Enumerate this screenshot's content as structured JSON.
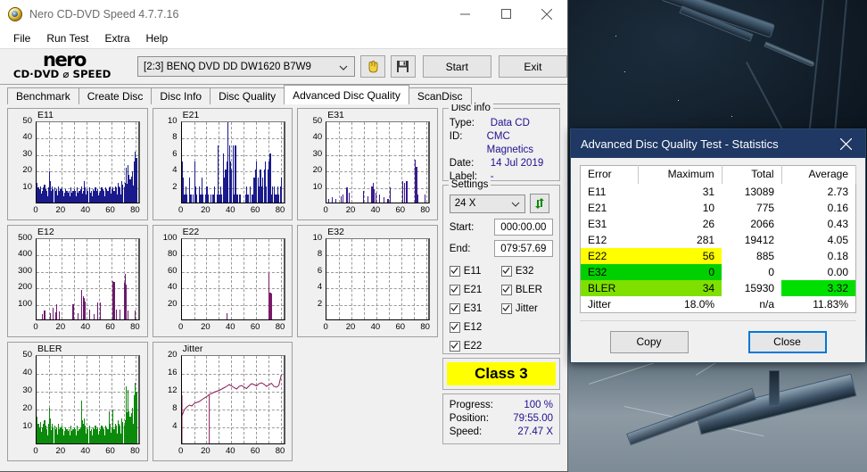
{
  "window": {
    "title": "Nero CD-DVD Speed 4.7.7.16",
    "icon": "nero-disc-icon",
    "controls": {
      "minimize": "minimize-icon",
      "maximize": "maximize-icon",
      "close": "close-icon"
    }
  },
  "menubar": {
    "items": [
      "File",
      "Run Test",
      "Extra",
      "Help"
    ]
  },
  "toolbar": {
    "logo_word": "nero",
    "logo_sub": "CD·DVD ⌀ SPEED",
    "drive": "[2:3]   BENQ DVD DD DW1620 B7W9",
    "eject_icon": "eject-hand-icon",
    "save_icon": "floppy-save-icon",
    "start_label": "Start",
    "exit_label": "Exit"
  },
  "tabs": {
    "items": [
      "Benchmark",
      "Create Disc",
      "Disc Info",
      "Disc Quality",
      "Advanced Disc Quality",
      "ScanDisc"
    ],
    "active": "Advanced Disc Quality"
  },
  "disc_info": {
    "legend": "Disc info",
    "rows": [
      {
        "key": "Type:",
        "value": "Data CD"
      },
      {
        "key": "ID:",
        "value": "CMC Magnetics"
      },
      {
        "key": "Date:",
        "value": "14 Jul 2019"
      },
      {
        "key": "Label:",
        "value": "-"
      }
    ]
  },
  "settings": {
    "legend": "Settings",
    "speed": "24 X",
    "refresh_icon": "refresh-speed-icon",
    "start_label": "Start:",
    "start_value": "000:00.00",
    "end_label": "End:",
    "end_value": "079:57.69",
    "checkboxes": [
      {
        "label": "E11",
        "checked": true
      },
      {
        "label": "E32",
        "checked": true
      },
      {
        "label": "E21",
        "checked": true
      },
      {
        "label": "BLER",
        "checked": true
      },
      {
        "label": "E31",
        "checked": true
      },
      {
        "label": "Jitter",
        "checked": true
      },
      {
        "label": "E12",
        "checked": true
      },
      {
        "label": "",
        "checked": false
      },
      {
        "label": "E22",
        "checked": true
      },
      {
        "label": "",
        "checked": false
      }
    ]
  },
  "class_box": {
    "label": "Class 3",
    "color": "#ffff00"
  },
  "progress": {
    "rows": [
      {
        "key": "Progress:",
        "value": "100 %"
      },
      {
        "key": "Position:",
        "value": "79:55.00"
      },
      {
        "key": "Speed:",
        "value": "27.47 X"
      }
    ]
  },
  "stats_dialog": {
    "title": "Advanced Disc Quality Test - Statistics",
    "close_icon": "close-icon",
    "columns": [
      "Error",
      "Maximum",
      "Total",
      "Average"
    ],
    "rows": [
      {
        "error": "E11",
        "maximum": "31",
        "total": "13089",
        "average": "2.73",
        "hl": null,
        "avg_hl": null
      },
      {
        "error": "E21",
        "maximum": "10",
        "total": "775",
        "average": "0.16",
        "hl": null,
        "avg_hl": null
      },
      {
        "error": "E31",
        "maximum": "26",
        "total": "2066",
        "average": "0.43",
        "hl": null,
        "avg_hl": null
      },
      {
        "error": "E12",
        "maximum": "281",
        "total": "19412",
        "average": "4.05",
        "hl": null,
        "avg_hl": null
      },
      {
        "error": "E22",
        "maximum": "56",
        "total": "885",
        "average": "0.18",
        "hl": "#ffff00",
        "avg_hl": null
      },
      {
        "error": "E32",
        "maximum": "0",
        "total": "0",
        "average": "0.00",
        "hl": "#00d000",
        "avg_hl": null
      },
      {
        "error": "BLER",
        "maximum": "34",
        "total": "15930",
        "average": "3.32",
        "hl": "#7fe000",
        "avg_hl": "#00e000"
      },
      {
        "error": "Jitter",
        "maximum": "18.0%",
        "total": "n/a",
        "average": "11.83%",
        "hl": null,
        "avg_hl": null
      }
    ],
    "copy_label": "Copy",
    "close_label": "Close"
  },
  "chart_data": [
    {
      "type": "bar",
      "title": "E11",
      "color": "#1a1a8c",
      "xlabel": "",
      "ylabel": "",
      "xlim": [
        0,
        84
      ],
      "ylim": [
        0,
        50
      ],
      "grid": true,
      "yticks": [
        10,
        20,
        30,
        40,
        50
      ],
      "xticks": [
        0,
        20,
        40,
        60,
        80
      ],
      "x": [
        0,
        1,
        2,
        3,
        4,
        5,
        6,
        7,
        8,
        9,
        10,
        11,
        12,
        13,
        14,
        15,
        16,
        17,
        18,
        19,
        20,
        21,
        22,
        23,
        24,
        25,
        26,
        27,
        28,
        29,
        30,
        31,
        32,
        33,
        34,
        35,
        36,
        37,
        38,
        39,
        40,
        41,
        42,
        43,
        44,
        45,
        46,
        47,
        48,
        49,
        50,
        51,
        52,
        53,
        54,
        55,
        56,
        57,
        58,
        59,
        60,
        61,
        62,
        63,
        64,
        65,
        66,
        67,
        68,
        69,
        70,
        71,
        72,
        73,
        74,
        75,
        76,
        77,
        78,
        79,
        80
      ],
      "values": [
        12,
        9,
        8,
        10,
        7,
        9,
        11,
        8,
        7,
        9,
        19,
        13,
        10,
        8,
        9,
        7,
        8,
        10,
        7,
        8,
        9,
        7,
        6,
        8,
        7,
        6,
        7,
        9,
        6,
        7,
        8,
        7,
        9,
        6,
        7,
        8,
        10,
        7,
        13,
        9,
        8,
        7,
        9,
        6,
        7,
        8,
        7,
        9,
        7,
        8,
        6,
        7,
        9,
        8,
        7,
        9,
        8,
        7,
        9,
        10,
        8,
        9,
        7,
        10,
        9,
        12,
        10,
        9,
        13,
        11,
        9,
        12,
        21,
        23,
        17,
        14,
        16,
        19,
        25,
        31,
        27
      ]
    },
    {
      "type": "bar",
      "title": "E21",
      "color": "#1a1a8c",
      "xlabel": "",
      "ylabel": "",
      "xlim": [
        0,
        84
      ],
      "ylim": [
        0,
        10
      ],
      "grid": true,
      "yticks": [
        2,
        4,
        6,
        8,
        10
      ],
      "xticks": [
        0,
        20,
        40,
        60,
        80
      ],
      "x": [
        0,
        1,
        2,
        3,
        4,
        5,
        6,
        7,
        8,
        9,
        10,
        11,
        12,
        13,
        14,
        15,
        16,
        17,
        18,
        19,
        20,
        21,
        22,
        23,
        24,
        25,
        26,
        27,
        28,
        29,
        30,
        31,
        32,
        33,
        34,
        35,
        36,
        37,
        38,
        39,
        40,
        41,
        42,
        43,
        44,
        45,
        46,
        47,
        48,
        49,
        50,
        51,
        52,
        53,
        54,
        55,
        56,
        57,
        58,
        59,
        60,
        61,
        62,
        63,
        64,
        65,
        66,
        67,
        68,
        69,
        70,
        71,
        72,
        73,
        74,
        75,
        76,
        77,
        78,
        79,
        80
      ],
      "values": [
        5,
        3,
        1,
        2,
        1,
        0,
        3,
        1,
        0,
        1,
        5,
        2,
        1,
        0,
        2,
        1,
        3,
        1,
        0,
        1,
        2,
        1,
        0,
        1,
        0,
        1,
        2,
        0,
        1,
        7,
        1,
        2,
        1,
        6,
        3,
        4,
        5,
        10,
        7,
        5,
        4,
        7,
        1,
        7,
        1,
        1,
        1,
        1,
        0,
        0,
        0,
        1,
        2,
        1,
        0,
        2,
        1,
        1,
        3,
        4,
        5,
        3,
        2,
        4,
        2,
        3,
        4,
        5,
        2,
        4,
        5,
        6,
        1,
        2,
        2,
        1,
        1,
        2,
        1,
        2,
        3
      ]
    },
    {
      "type": "bar",
      "title": "E31",
      "color": "#3b1a8c",
      "xlabel": "",
      "ylabel": "",
      "xlim": [
        0,
        84
      ],
      "ylim": [
        0,
        50
      ],
      "grid": true,
      "yticks": [
        10,
        20,
        30,
        40,
        50
      ],
      "xticks": [
        0,
        20,
        40,
        60,
        80
      ],
      "x": [
        0,
        1,
        2,
        3,
        4,
        5,
        6,
        7,
        8,
        9,
        10,
        11,
        12,
        13,
        14,
        15,
        16,
        17,
        18,
        19,
        20,
        21,
        22,
        23,
        24,
        25,
        26,
        27,
        28,
        29,
        30,
        31,
        32,
        33,
        34,
        35,
        36,
        37,
        38,
        39,
        40,
        41,
        42,
        43,
        44,
        45,
        46,
        47,
        48,
        49,
        50,
        51,
        52,
        53,
        54,
        55,
        56,
        57,
        58,
        59,
        60,
        61,
        62,
        63,
        64,
        65,
        66,
        67,
        68,
        69,
        70,
        71,
        72,
        73,
        74,
        75,
        76,
        77,
        78,
        79,
        80
      ],
      "values": [
        0,
        2,
        0,
        0,
        3,
        0,
        0,
        2,
        0,
        0,
        0,
        4,
        0,
        5,
        0,
        0,
        9,
        0,
        6,
        0,
        0,
        0,
        0,
        0,
        0,
        0,
        0,
        0,
        0,
        7,
        0,
        0,
        0,
        4,
        0,
        0,
        10,
        12,
        8,
        6,
        0,
        0,
        5,
        0,
        0,
        0,
        3,
        0,
        0,
        2,
        0,
        9,
        0,
        0,
        0,
        0,
        0,
        0,
        0,
        0,
        0,
        13,
        12,
        0,
        13,
        0,
        0,
        0,
        0,
        0,
        0,
        26,
        22,
        5,
        0,
        0,
        0,
        0,
        0,
        5,
        0
      ]
    },
    {
      "type": "bar",
      "title": "E12",
      "color": "#6b1a6b",
      "xlabel": "",
      "ylabel": "",
      "xlim": [
        0,
        84
      ],
      "ylim": [
        0,
        500
      ],
      "grid": true,
      "yticks": [
        100,
        200,
        300,
        400,
        500
      ],
      "xticks": [
        0,
        20,
        40,
        60,
        80
      ],
      "x": [
        0,
        1,
        2,
        3,
        4,
        5,
        6,
        7,
        8,
        9,
        10,
        11,
        12,
        13,
        14,
        15,
        16,
        17,
        18,
        19,
        20,
        21,
        22,
        23,
        24,
        25,
        26,
        27,
        28,
        29,
        30,
        31,
        32,
        33,
        34,
        35,
        36,
        37,
        38,
        39,
        40,
        41,
        42,
        43,
        44,
        45,
        46,
        47,
        48,
        49,
        50,
        51,
        52,
        53,
        54,
        55,
        56,
        57,
        58,
        59,
        60,
        61,
        62,
        63,
        64,
        65,
        66,
        67,
        68,
        69,
        70,
        71,
        72,
        73,
        74,
        75,
        76,
        77,
        78,
        79,
        80
      ],
      "values": [
        0,
        0,
        0,
        0,
        30,
        0,
        55,
        0,
        0,
        0,
        0,
        40,
        0,
        70,
        0,
        45,
        95,
        0,
        50,
        0,
        0,
        0,
        0,
        0,
        0,
        0,
        0,
        0,
        0,
        90,
        0,
        0,
        0,
        40,
        0,
        0,
        180,
        140,
        130,
        110,
        0,
        0,
        60,
        0,
        0,
        0,
        30,
        0,
        0,
        105,
        0,
        105,
        0,
        0,
        0,
        0,
        0,
        0,
        0,
        0,
        0,
        235,
        230,
        0,
        60,
        0,
        0,
        60,
        0,
        0,
        225,
        275,
        210,
        55,
        0,
        0,
        0,
        0,
        0,
        55,
        0
      ]
    },
    {
      "type": "bar",
      "title": "E22",
      "color": "#7b1a6b",
      "xlabel": "",
      "ylabel": "",
      "xlim": [
        0,
        84
      ],
      "ylim": [
        0,
        100
      ],
      "grid": true,
      "yticks": [
        20,
        40,
        60,
        80,
        100
      ],
      "xticks": [
        0,
        20,
        40,
        60,
        80
      ],
      "x": [
        0,
        1,
        2,
        3,
        4,
        5,
        6,
        7,
        8,
        9,
        10,
        11,
        12,
        13,
        14,
        15,
        16,
        17,
        18,
        19,
        20,
        21,
        22,
        23,
        24,
        25,
        26,
        27,
        28,
        29,
        30,
        31,
        32,
        33,
        34,
        35,
        36,
        37,
        38,
        39,
        40,
        41,
        42,
        43,
        44,
        45,
        46,
        47,
        48,
        49,
        50,
        51,
        52,
        53,
        54,
        55,
        56,
        57,
        58,
        59,
        60,
        61,
        62,
        63,
        64,
        65,
        66,
        67,
        68,
        69,
        70,
        71,
        72,
        73,
        74,
        75,
        76,
        77,
        78,
        79,
        80
      ],
      "values": [
        0,
        0,
        0,
        0,
        0,
        0,
        0,
        0,
        0,
        0,
        0,
        0,
        0,
        0,
        0,
        0,
        0,
        0,
        0,
        0,
        0,
        0,
        0,
        0,
        0,
        0,
        0,
        0,
        0,
        0,
        0,
        0,
        0,
        0,
        0,
        0,
        8,
        0,
        0,
        0,
        0,
        0,
        0,
        0,
        0,
        0,
        0,
        0,
        0,
        0,
        0,
        0,
        0,
        0,
        0,
        0,
        0,
        0,
        0,
        0,
        0,
        0,
        0,
        0,
        0,
        0,
        0,
        0,
        0,
        0,
        56,
        33,
        32,
        0,
        0,
        0,
        0,
        0,
        0,
        0,
        0
      ]
    },
    {
      "type": "bar",
      "title": "E32",
      "color": "#6b1a6b",
      "xlabel": "",
      "ylabel": "",
      "xlim": [
        0,
        84
      ],
      "ylim": [
        0,
        10
      ],
      "grid": true,
      "yticks": [
        2,
        4,
        6,
        8,
        10
      ],
      "xticks": [
        0,
        20,
        40,
        60,
        80
      ],
      "x": [],
      "values": []
    },
    {
      "type": "bar",
      "title": "BLER",
      "color": "#0b8a0b",
      "xlabel": "",
      "ylabel": "",
      "xlim": [
        0,
        84
      ],
      "ylim": [
        0,
        50
      ],
      "grid": true,
      "yticks": [
        10,
        20,
        30,
        40,
        50
      ],
      "xticks": [
        0,
        20,
        40,
        60,
        80
      ],
      "x": [
        0,
        1,
        2,
        3,
        4,
        5,
        6,
        7,
        8,
        9,
        10,
        11,
        12,
        13,
        14,
        15,
        16,
        17,
        18,
        19,
        20,
        21,
        22,
        23,
        24,
        25,
        26,
        27,
        28,
        29,
        30,
        31,
        32,
        33,
        34,
        35,
        36,
        37,
        38,
        39,
        40,
        41,
        42,
        43,
        44,
        45,
        46,
        47,
        48,
        49,
        50,
        51,
        52,
        53,
        54,
        55,
        56,
        57,
        58,
        59,
        60,
        61,
        62,
        63,
        64,
        65,
        66,
        67,
        68,
        69,
        70,
        71,
        72,
        73,
        74,
        75,
        76,
        77,
        78,
        79,
        80
      ],
      "values": [
        15,
        11,
        9,
        12,
        9,
        11,
        13,
        10,
        8,
        11,
        20,
        14,
        11,
        9,
        10,
        8,
        9,
        11,
        8,
        9,
        10,
        8,
        7,
        9,
        8,
        7,
        8,
        10,
        7,
        8,
        9,
        8,
        10,
        7,
        8,
        9,
        24,
        11,
        14,
        10,
        9,
        8,
        10,
        7,
        8,
        9,
        8,
        10,
        8,
        9,
        7,
        8,
        10,
        9,
        8,
        10,
        9,
        8,
        18,
        11,
        9,
        19,
        8,
        11,
        10,
        13,
        11,
        10,
        14,
        12,
        10,
        13,
        32,
        30,
        18,
        15,
        17,
        20,
        27,
        34,
        29
      ]
    },
    {
      "type": "line",
      "title": "Jitter",
      "color": "#8c1a55",
      "xlabel": "",
      "ylabel": "",
      "xlim": [
        0,
        84
      ],
      "ylim": [
        0,
        20
      ],
      "grid": true,
      "yticks": [
        4,
        8,
        12,
        16,
        20
      ],
      "xticks": [
        0,
        20,
        40,
        60,
        80
      ],
      "x": [
        0,
        2,
        4,
        6,
        8,
        10,
        12,
        14,
        16,
        18,
        20,
        22,
        24,
        26,
        28,
        30,
        32,
        34,
        36,
        38,
        40,
        42,
        44,
        46,
        48,
        50,
        52,
        54,
        56,
        58,
        60,
        62,
        64,
        66,
        68,
        70,
        72,
        74,
        76,
        78,
        80
      ],
      "values": [
        6.6,
        8.0,
        8.6,
        9.0,
        8.8,
        9.4,
        9.6,
        9.8,
        10.2,
        10.6,
        10.9,
        11.4,
        11.6,
        11.9,
        12.1,
        12.3,
        12.6,
        12.9,
        13.2,
        13.6,
        13.3,
        12.9,
        12.6,
        13.2,
        13.4,
        13.0,
        12.7,
        13.3,
        13.8,
        13.6,
        13.3,
        13.8,
        14.0,
        13.7,
        13.2,
        13.5,
        13.9,
        13.2,
        13.0,
        13.4,
        15.8
      ]
    }
  ]
}
